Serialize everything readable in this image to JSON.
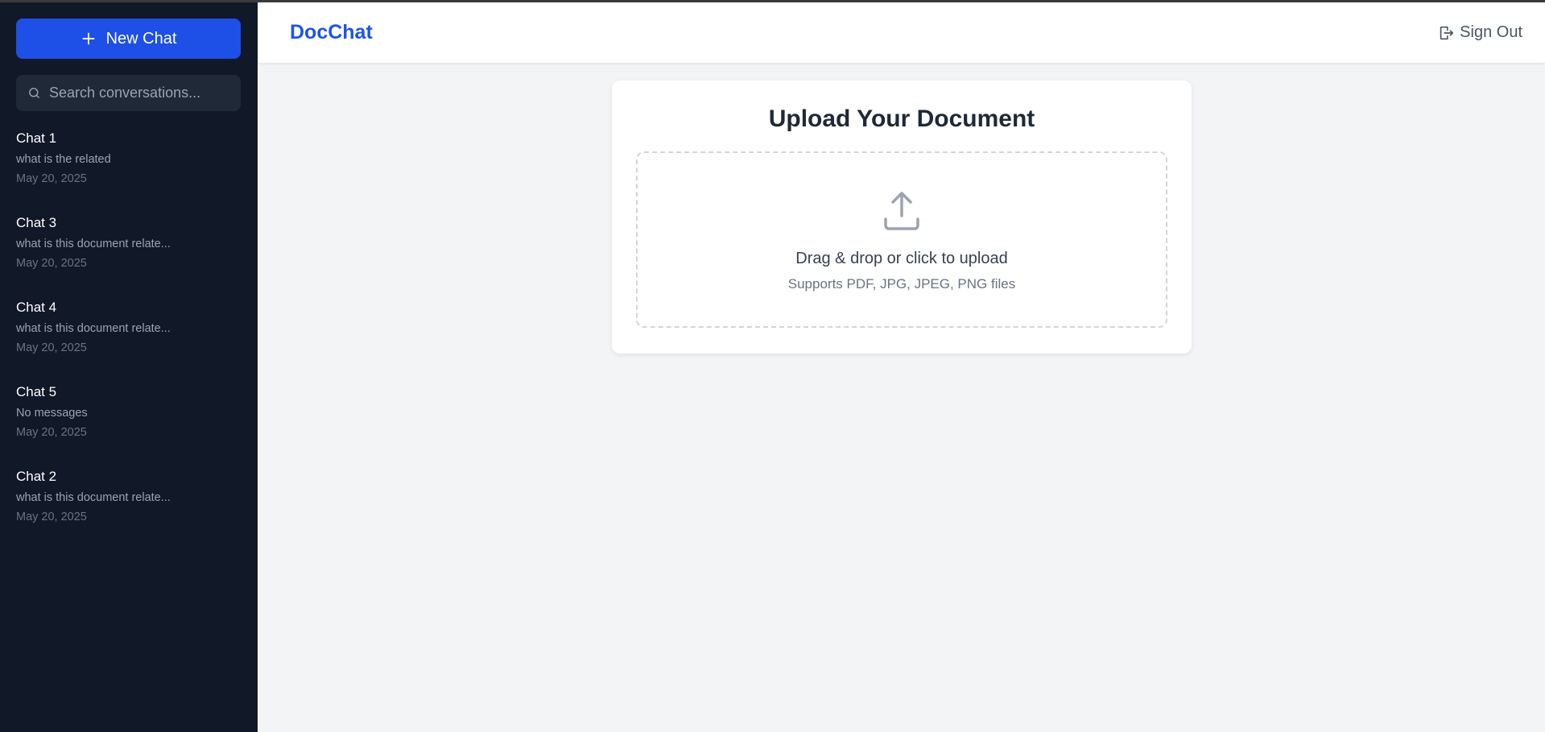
{
  "sidebar": {
    "new_chat_label": "New Chat",
    "search_placeholder": "Search conversations...",
    "chats": [
      {
        "title": "Chat 1",
        "preview": "what is the related",
        "date": "May 20, 2025"
      },
      {
        "title": "Chat 3",
        "preview": "what is this document relate...",
        "date": "May 20, 2025"
      },
      {
        "title": "Chat 4",
        "preview": "what is this document relate...",
        "date": "May 20, 2025"
      },
      {
        "title": "Chat 5",
        "preview": "No messages",
        "date": "May 20, 2025"
      },
      {
        "title": "Chat 2",
        "preview": "what is this document relate...",
        "date": "May 20, 2025"
      }
    ]
  },
  "header": {
    "brand": "DocChat",
    "signout_label": "Sign Out"
  },
  "upload": {
    "title": "Upload Your Document",
    "instruction": "Drag & drop or click to upload",
    "supported": "Supports PDF, JPG, JPEG, PNG files"
  },
  "icons": {
    "new_chat": "plus-icon",
    "search": "search-icon",
    "signout": "sign-out-icon",
    "upload": "upload-icon"
  },
  "colors": {
    "accent": "#1e4fe6",
    "brand": "#1e55e6",
    "sidebar_bg": "#111827",
    "search_bg": "#1f2937",
    "main_bg": "#f3f4f6"
  }
}
